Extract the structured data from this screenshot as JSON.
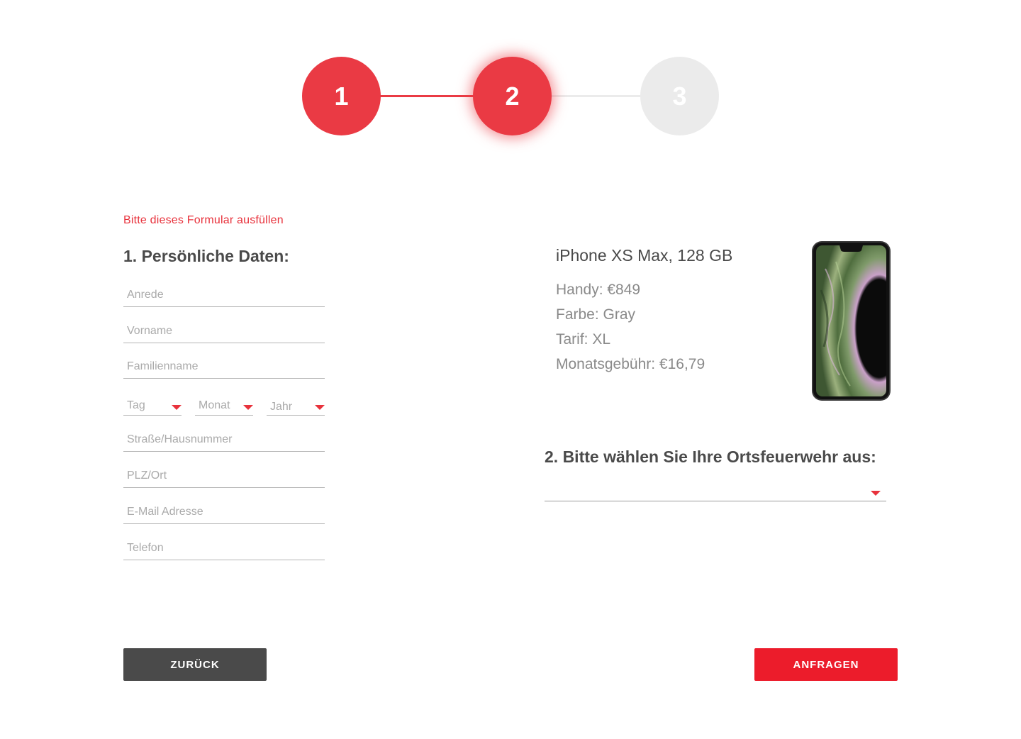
{
  "stepper": {
    "steps": [
      {
        "label": "1",
        "state": "done"
      },
      {
        "label": "2",
        "state": "active"
      },
      {
        "label": "3",
        "state": "pending"
      }
    ]
  },
  "form": {
    "hint": "Bitte dieses Formular ausfüllen",
    "section1_title": "1. Persönliche Daten:",
    "fields": {
      "anrede": "Anrede",
      "vorname": "Vorname",
      "familienname": "Familienname",
      "strasse": "Straße/Hausnummer",
      "plz_ort": "PLZ/Ort",
      "email": "E-Mail Adresse",
      "telefon": "Telefon"
    },
    "birthdate": {
      "day": "Tag",
      "month": "Monat",
      "year": "Jahr"
    }
  },
  "product": {
    "name": "iPhone XS Max, 128 GB",
    "handy": "Handy: €849",
    "farbe": "Farbe: Gray",
    "tarif": "Tarif: XL",
    "monatsgebuehr": "Monatsgebühr: €16,79",
    "image": "phone-image"
  },
  "section2": {
    "title": "2. Bitte wählen Sie Ihre Ortsfeuerwehr aus:",
    "selected": ""
  },
  "buttons": {
    "back": "ZURÜCK",
    "submit": "ANFRAGEN"
  },
  "colors": {
    "accent": "#ea3a44",
    "button_submit": "#ec1c2b",
    "button_back": "#4a4a4a",
    "inactive_step": "#ebebeb",
    "text": "#4a4a4a"
  }
}
